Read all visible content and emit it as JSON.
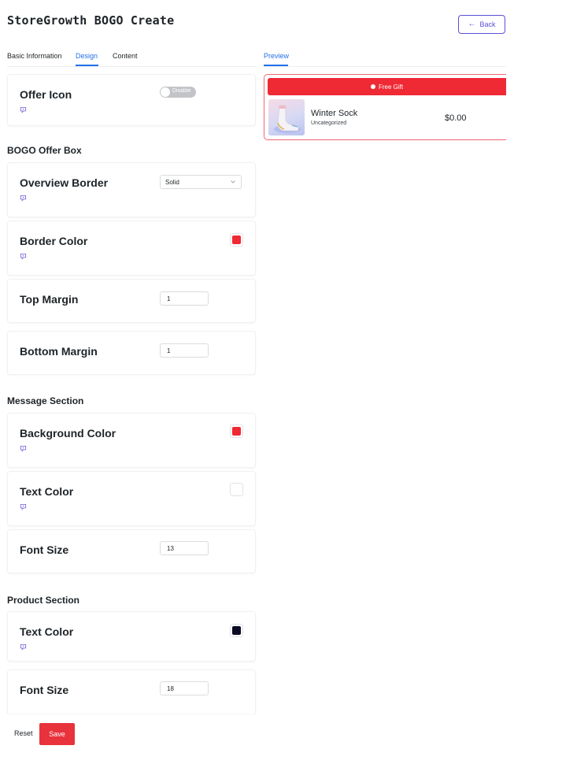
{
  "header": {
    "title": "StoreGrowth BOGO Create",
    "back_label": "Back"
  },
  "tabs": [
    {
      "label": "Basic Information",
      "active": false
    },
    {
      "label": "Design",
      "active": true
    },
    {
      "label": "Content",
      "active": false
    }
  ],
  "preview": {
    "tab_label": "Preview",
    "gift_label": "Free Gift",
    "product": {
      "name": "Winter Sock",
      "category": "Uncategorized",
      "price": "$0.00"
    }
  },
  "offer_icon": {
    "label": "Offer Icon",
    "toggle_label": "Disable",
    "enabled": false
  },
  "bogo_offer_box": {
    "title": "BOGO Offer Box",
    "overview_border": {
      "label": "Overview Border",
      "value": "Solid"
    },
    "border_color": {
      "label": "Border Color",
      "value": "#ef2a35"
    },
    "top_margin": {
      "label": "Top Margin",
      "value": "1"
    },
    "bottom_margin": {
      "label": "Bottom Margin",
      "value": "1"
    }
  },
  "message_section": {
    "title": "Message Section",
    "background_color": {
      "label": "Background Color",
      "value": "#ef2a35"
    },
    "text_color": {
      "label": "Text Color",
      "value": "#ffffff"
    },
    "font_size": {
      "label": "Font Size",
      "value": "13"
    }
  },
  "product_section": {
    "title": "Product Section",
    "text_color": {
      "label": "Text Color",
      "value": "#0a0a23"
    },
    "font_size": {
      "label": "Font Size",
      "value": "18"
    }
  },
  "footer": {
    "reset_label": "Reset",
    "save_label": "Save"
  },
  "colors": {
    "accent_blue": "#2271e8",
    "back_purple": "#5b4fd6",
    "save_red": "#e8323c"
  }
}
